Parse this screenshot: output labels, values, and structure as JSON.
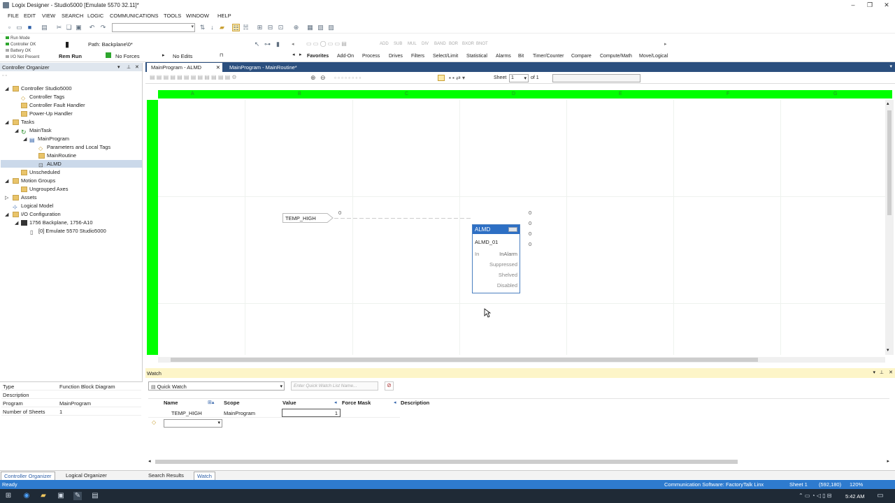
{
  "window": {
    "title": "Logix Designer - Studio5000 [Emulate 5570 32.11]*"
  },
  "menu": [
    "FILE",
    "EDIT",
    "VIEW",
    "SEARCH",
    "LOGIC",
    "COMMUNICATIONS",
    "TOOLS",
    "WINDOW",
    "HELP"
  ],
  "status": {
    "run_mode": "Run Mode",
    "controller_ok": "Controller OK",
    "battery_ok": "Battery OK",
    "io": "I/O Not Present",
    "path_label": "Path: Backplane\\0*",
    "mode": "Rem Run",
    "forces": "No Forces",
    "edits": "No Edits"
  },
  "instr_buttons": [
    "ADD",
    "SUB",
    "MUL",
    "DIV",
    "BAND",
    "BOR",
    "BXOR",
    "BNOT"
  ],
  "instr_tabs": [
    "Favorites",
    "Add-On",
    "Process",
    "Drives",
    "Filters",
    "Select/Limit",
    "Statistical",
    "Alarms",
    "Bit",
    "Timer/Counter",
    "Compare",
    "Compute/Math",
    "Move/Logical"
  ],
  "left_panel": {
    "title": "Controller Organizer",
    "tree": [
      {
        "label": "Controller Studio5000"
      },
      {
        "label": "Controller Tags"
      },
      {
        "label": "Controller Fault Handler"
      },
      {
        "label": "Power-Up Handler"
      },
      {
        "label": "Tasks"
      },
      {
        "label": "MainTask"
      },
      {
        "label": "MainProgram"
      },
      {
        "label": "Parameters and Local Tags"
      },
      {
        "label": "MainRoutine"
      },
      {
        "label": "ALMD"
      },
      {
        "label": "Unscheduled"
      },
      {
        "label": "Motion Groups"
      },
      {
        "label": "Ungrouped Axes"
      },
      {
        "label": "Assets"
      },
      {
        "label": "Logical Model"
      },
      {
        "label": "I/O Configuration"
      },
      {
        "label": "1756 Backplane, 1756-A10"
      },
      {
        "label": "[0] Emulate 5570 Studio5000"
      }
    ]
  },
  "properties": [
    {
      "k": "Type",
      "v": "Function Block Diagram"
    },
    {
      "k": "Description",
      "v": ""
    },
    {
      "k": "Program",
      "v": "MainProgram"
    },
    {
      "k": "Number of Sheets",
      "v": "1"
    }
  ],
  "editor": {
    "tabs": [
      "MainProgram - ALMD",
      "MainProgram - MainRoutine*"
    ],
    "sheet_label": "Sheet",
    "sheet_value": "1",
    "sheet_of": "of 1",
    "input_ref": {
      "tag": "TEMP_HIGH",
      "value": "0"
    },
    "block": {
      "type": "ALMD",
      "name": "ALMD_01",
      "in_pin": "In",
      "outputs": [
        {
          "label": "InAlarm",
          "value": "0"
        },
        {
          "label": "Suppressed",
          "value": "0"
        },
        {
          "label": "Shelved",
          "value": "0"
        },
        {
          "label": "Disabled",
          "value": "0"
        }
      ]
    }
  },
  "watch": {
    "title": "Watch",
    "mode": "Quick Watch",
    "placeholder": "Enter Quick Watch List Name...",
    "columns": [
      "Name",
      "Scope",
      "Value",
      "Force Mask",
      "Description"
    ],
    "rows": [
      {
        "name": "TEMP_HIGH",
        "scope": "MainProgram",
        "value": "1",
        "force": "",
        "desc": ""
      }
    ]
  },
  "bottom_tabs": {
    "left": [
      "Controller Organizer",
      "Logical Organizer"
    ],
    "right": [
      "Search Results",
      "Watch"
    ]
  },
  "statusbar": {
    "left": "Ready",
    "comm": "Communication Software: FactoryTalk Linx",
    "sheet": "Sheet 1",
    "coords": "(592,180)",
    "zoom": "120%"
  },
  "taskbar": {
    "time": "5:42 AM"
  }
}
